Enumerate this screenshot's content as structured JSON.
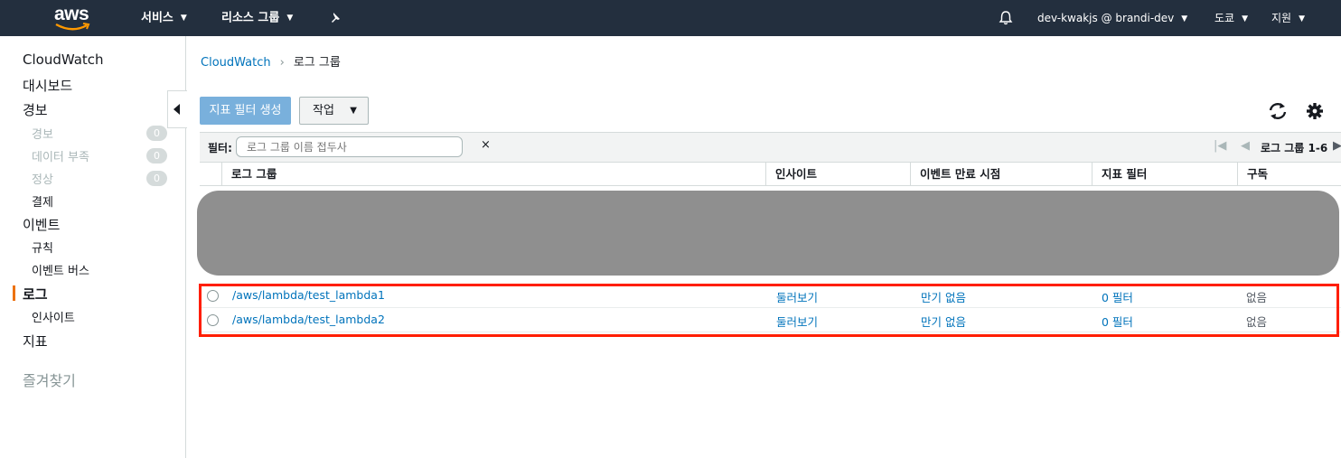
{
  "topnav": {
    "logo": "aws",
    "services": "서비스",
    "resource_groups": "리소스 그룹",
    "account": "dev-kwakjs @ brandi-dev",
    "region": "도쿄",
    "support": "지원"
  },
  "sidebar": {
    "title": "CloudWatch",
    "dashboard": "대시보드",
    "alarms": "경보",
    "alarms_sub": [
      {
        "label": "경보",
        "count": "0"
      },
      {
        "label": "데이터 부족",
        "count": "0"
      },
      {
        "label": "정상",
        "count": "0"
      }
    ],
    "billing": "결제",
    "events": "이벤트",
    "rules": "규칙",
    "event_buses": "이벤트 버스",
    "logs": "로그",
    "insights": "인사이트",
    "metrics": "지표",
    "favorites": "즐겨찾기"
  },
  "breadcrumb": {
    "root": "CloudWatch",
    "current": "로그 그룹"
  },
  "toolbar": {
    "create_metric_filter": "지표 필터 생성",
    "actions": "작업"
  },
  "filter": {
    "label": "필터:",
    "placeholder": "로그 그룹 이름 접두사",
    "clear": "×"
  },
  "pager": {
    "label": "로그 그룹 1-6"
  },
  "table": {
    "columns": [
      "로그 그룹",
      "인사이트",
      "이벤트 만료 시점",
      "지표 필터",
      "구독"
    ],
    "rows": [
      {
        "log_group": "/aws/lambda/test_lambda1",
        "insights": "둘러보기",
        "expire": "만기 없음",
        "metric_filters": "0 필터",
        "subscription": "없음"
      },
      {
        "log_group": "/aws/lambda/test_lambda2",
        "insights": "둘러보기",
        "expire": "만기 없음",
        "metric_filters": "0 필터",
        "subscription": "없음"
      }
    ]
  }
}
